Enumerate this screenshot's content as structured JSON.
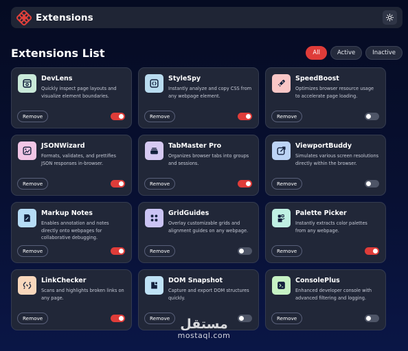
{
  "header": {
    "brand": "Extensions",
    "logo_icon": "extensions-logo-icon",
    "theme_icon": "sun-icon",
    "logo_color": "#e0403b"
  },
  "list": {
    "title": "Extensions List",
    "filters": [
      {
        "label": "All",
        "active": true
      },
      {
        "label": "Active",
        "active": false
      },
      {
        "label": "Inactive",
        "active": false
      }
    ]
  },
  "accent_color": "#df3c39",
  "remove_label": "Remove",
  "extensions": [
    {
      "name": "DevLens",
      "description": "Quickly inspect page layouts and visualize element boundaries.",
      "enabled": true,
      "icon": "inspect-icon",
      "icon_bg": "#c9e9d9"
    },
    {
      "name": "StyleSpy",
      "description": "Instantly analyze and copy CSS from any webpage element.",
      "enabled": true,
      "icon": "code-braces-icon",
      "icon_bg": "#b9dcf0"
    },
    {
      "name": "SpeedBoost",
      "description": "Optimizes browser resource usage to accelerate page loading.",
      "enabled": false,
      "icon": "rocket-icon",
      "icon_bg": "#f9c6c6"
    },
    {
      "name": "JSONWizard",
      "description": "Formats, validates, and prettifies JSON responses in-browser.",
      "enabled": true,
      "icon": "image-edit-icon",
      "icon_bg": "#f2c6e6"
    },
    {
      "name": "TabMaster Pro",
      "description": "Organizes browser tabs into groups and sessions.",
      "enabled": true,
      "icon": "tabs-stack-icon",
      "icon_bg": "#d6c9f2"
    },
    {
      "name": "ViewportBuddy",
      "description": "Simulates various screen resolutions directly within the browser.",
      "enabled": false,
      "icon": "resize-arrow-icon",
      "icon_bg": "#bcd3f5"
    },
    {
      "name": "Markup Notes",
      "description": "Enables annotation and notes directly onto webpages for collaborative debugging.",
      "enabled": true,
      "icon": "note-pen-icon",
      "icon_bg": "#b6dcf6"
    },
    {
      "name": "GridGuides",
      "description": "Overlay customizable grids and alignment guides on any webpage.",
      "enabled": false,
      "icon": "grid-dots-icon",
      "icon_bg": "#cbc4f4"
    },
    {
      "name": "Palette Picker",
      "description": "Instantly extracts color palettes from any webpage.",
      "enabled": true,
      "icon": "palette-icon",
      "icon_bg": "#bff0e3"
    },
    {
      "name": "LinkChecker",
      "description": "Scans and highlights broken links on any page.",
      "enabled": true,
      "icon": "link-broken-icon",
      "icon_bg": "#f8d7bc"
    },
    {
      "name": "DOM Snapshot",
      "description": "Capture and export DOM structures quickly.",
      "enabled": false,
      "icon": "snapshot-icon",
      "icon_bg": "#bfe2f6"
    },
    {
      "name": "ConsolePlus",
      "description": "Enhanced developer console with advanced filtering and logging.",
      "enabled": false,
      "icon": "terminal-icon",
      "icon_bg": "#c6f2c4"
    }
  ],
  "watermark": {
    "arabic": "مستقل",
    "latin": "mostaql.com"
  }
}
